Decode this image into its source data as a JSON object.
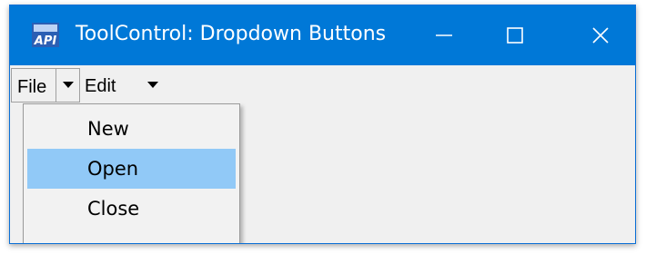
{
  "window": {
    "title": "ToolControl: Dropdown Buttons",
    "titlebar_color": "#0078d7",
    "icon": "api-app-icon"
  },
  "caption_buttons": [
    "minimize-icon",
    "maximize-icon",
    "close-icon"
  ],
  "toolbar": {
    "file_label": "File",
    "edit_label": "Edit"
  },
  "dropdown_menu": {
    "items": [
      {
        "label": "New",
        "highlighted": false
      },
      {
        "label": "Open",
        "highlighted": true
      },
      {
        "label": "Close",
        "highlighted": false
      }
    ],
    "highlight_color": "#91c9f7"
  }
}
